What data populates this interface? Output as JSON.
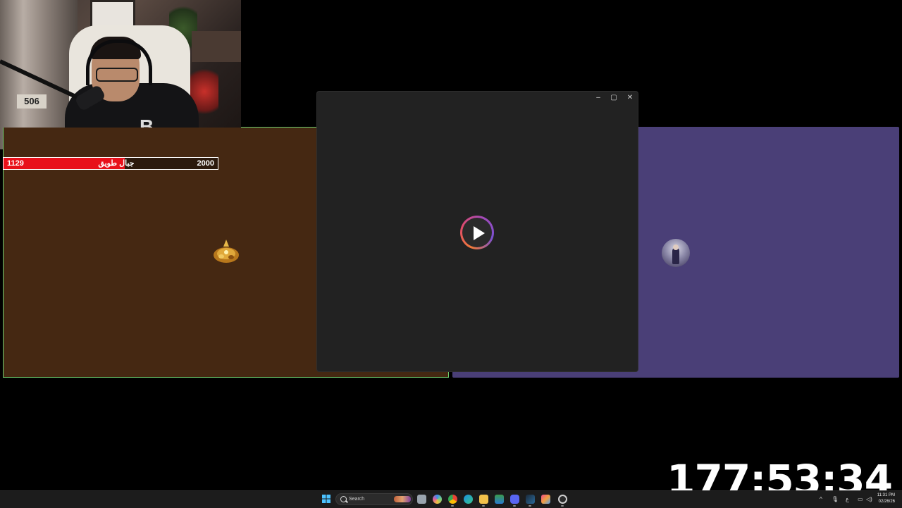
{
  "health_bar": {
    "current": "1129",
    "name": "جبال طويق",
    "max": "2000",
    "fill_fraction": 0.565
  },
  "webcam": {
    "shirt_letter": "B",
    "clock_digits": "506"
  },
  "player": {
    "minimize_label": "–",
    "maximize_label": "▢",
    "close_label": "✕"
  },
  "timer": {
    "value": "177:53:34"
  },
  "taskbar": {
    "search_label": "Search",
    "apps": [
      "file-explorer",
      "copilot",
      "chrome",
      "edge",
      "folder",
      "store",
      "discord",
      "steam",
      "photos",
      "obs"
    ],
    "tray": {
      "chevron": "^",
      "lang": "ع",
      "time": "11:31 PM",
      "date": "02/26/26"
    }
  },
  "colors": {
    "left_panel": "#452812",
    "right_panel": "#4a3f77",
    "health_fill": "#e8101a",
    "panel_border": "#6fd06f"
  }
}
